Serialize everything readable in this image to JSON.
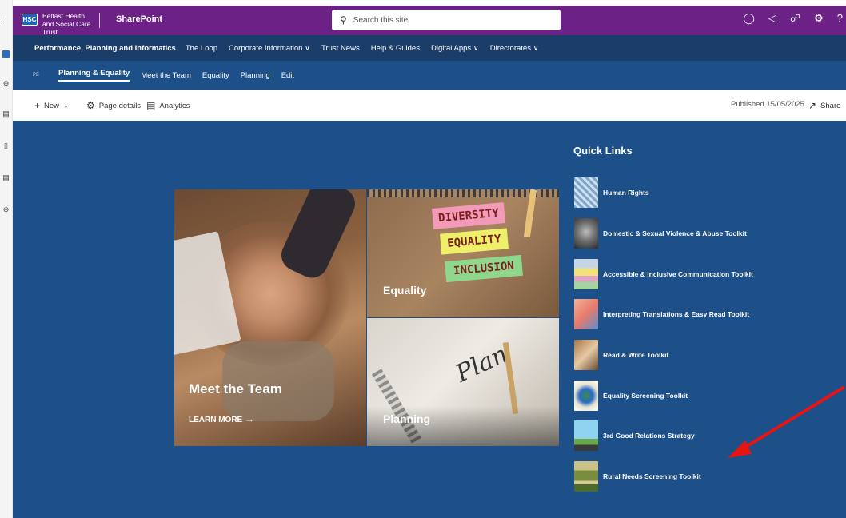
{
  "suite": {
    "org_name": "Belfast Health and Social Care Trust",
    "badge": "HSC",
    "app_name": "SharePoint",
    "search_placeholder": "Search this site"
  },
  "hub_nav": {
    "title": "Performance, Planning and Informatics",
    "items": [
      {
        "label": "The Loop"
      },
      {
        "label": "Corporate Information ∨"
      },
      {
        "label": "Trust News"
      },
      {
        "label": "Help & Guides"
      },
      {
        "label": "Digital Apps ∨"
      },
      {
        "label": "Directorates ∨"
      }
    ]
  },
  "site_nav": {
    "site_logo": "PE",
    "items": [
      {
        "label": "Planning & Equality",
        "active": true
      },
      {
        "label": "Meet the Team"
      },
      {
        "label": "Equality"
      },
      {
        "label": "Planning"
      },
      {
        "label": "Edit"
      }
    ]
  },
  "command_bar": {
    "new_label": "New",
    "page_details_label": "Page details",
    "analytics_label": "Analytics",
    "published": "Published 15/05/2025",
    "share_label": "Share"
  },
  "hero": {
    "meet_title": "Meet the Team",
    "learn_more": "LEARN MORE",
    "equality_title": "Equality",
    "planning_title": "Planning",
    "sticky_notes": [
      "DIVERSITY",
      "EQUALITY",
      "INCLUSION"
    ],
    "plan_word": "Plan"
  },
  "quick_links": {
    "title": "Quick Links",
    "items": [
      {
        "label": "Human Rights"
      },
      {
        "label": "Domestic & Sexual Violence & Abuse Toolkit"
      },
      {
        "label": "Accessible & Inclusive Communication Toolkit"
      },
      {
        "label": "Interpreting Translations & Easy Read Toolkit"
      },
      {
        "label": "Read & Write Toolkit"
      },
      {
        "label": "Equality Screening Toolkit"
      },
      {
        "label": "3rd Good Relations Strategy"
      },
      {
        "label": "Rural Needs Screening Toolkit"
      }
    ]
  },
  "colors": {
    "suite_bar": "#6b2186",
    "hub_nav": "#1b3d6a",
    "site_nav": "#1d4f89",
    "canvas": "#1d4f89",
    "annotation_arrow": "#e81414"
  }
}
